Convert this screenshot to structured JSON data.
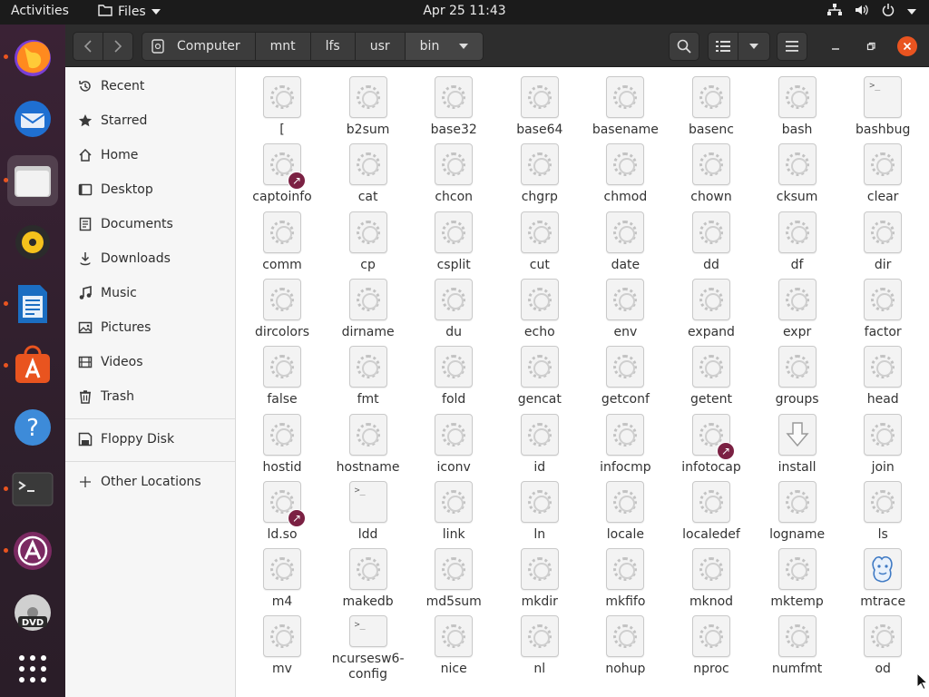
{
  "topbar": {
    "activities": "Activities",
    "app_name": "Files",
    "clock": "Apr 25  11:43"
  },
  "dock": {
    "items": [
      {
        "name": "firefox",
        "running": true
      },
      {
        "name": "thunderbird",
        "running": false
      },
      {
        "name": "files",
        "running": true,
        "active": true
      },
      {
        "name": "rhythmbox",
        "running": false
      },
      {
        "name": "libreoffice-writer",
        "running": true
      },
      {
        "name": "ubuntu-software",
        "running": true
      },
      {
        "name": "help",
        "running": false
      },
      {
        "name": "terminal",
        "running": true
      },
      {
        "name": "software-updater",
        "running": true
      },
      {
        "name": "dvd",
        "running": false
      },
      {
        "name": "show-applications",
        "running": false
      }
    ]
  },
  "path": [
    "Computer",
    "mnt",
    "lfs",
    "usr",
    "bin"
  ],
  "sidebar": {
    "items": [
      {
        "label": "Recent",
        "icon": "clock-icon"
      },
      {
        "label": "Starred",
        "icon": "star-icon"
      },
      {
        "label": "Home",
        "icon": "home-icon"
      },
      {
        "label": "Desktop",
        "icon": "desktop-icon"
      },
      {
        "label": "Documents",
        "icon": "document-icon"
      },
      {
        "label": "Downloads",
        "icon": "download-icon"
      },
      {
        "label": "Music",
        "icon": "music-icon"
      },
      {
        "label": "Pictures",
        "icon": "picture-icon"
      },
      {
        "label": "Videos",
        "icon": "video-icon"
      },
      {
        "label": "Trash",
        "icon": "trash-icon"
      }
    ],
    "devices": [
      {
        "label": "Floppy Disk",
        "icon": "floppy-icon"
      }
    ],
    "other": {
      "label": "Other Locations",
      "icon": "plus-icon"
    }
  },
  "files": [
    {
      "name": "[",
      "icon": "executable"
    },
    {
      "name": "b2sum",
      "icon": "executable"
    },
    {
      "name": "base32",
      "icon": "executable"
    },
    {
      "name": "base64",
      "icon": "executable"
    },
    {
      "name": "basename",
      "icon": "executable"
    },
    {
      "name": "basenc",
      "icon": "executable"
    },
    {
      "name": "bash",
      "icon": "executable"
    },
    {
      "name": "bashbug",
      "icon": "script"
    },
    {
      "name": "captoinfo",
      "icon": "executable",
      "link": true
    },
    {
      "name": "cat",
      "icon": "executable"
    },
    {
      "name": "chcon",
      "icon": "executable"
    },
    {
      "name": "chgrp",
      "icon": "executable"
    },
    {
      "name": "chmod",
      "icon": "executable"
    },
    {
      "name": "chown",
      "icon": "executable"
    },
    {
      "name": "cksum",
      "icon": "executable"
    },
    {
      "name": "clear",
      "icon": "executable"
    },
    {
      "name": "comm",
      "icon": "executable"
    },
    {
      "name": "cp",
      "icon": "executable"
    },
    {
      "name": "csplit",
      "icon": "executable"
    },
    {
      "name": "cut",
      "icon": "executable"
    },
    {
      "name": "date",
      "icon": "executable"
    },
    {
      "name": "dd",
      "icon": "executable"
    },
    {
      "name": "df",
      "icon": "executable"
    },
    {
      "name": "dir",
      "icon": "executable"
    },
    {
      "name": "dircolors",
      "icon": "executable"
    },
    {
      "name": "dirname",
      "icon": "executable"
    },
    {
      "name": "du",
      "icon": "executable"
    },
    {
      "name": "echo",
      "icon": "executable"
    },
    {
      "name": "env",
      "icon": "executable"
    },
    {
      "name": "expand",
      "icon": "executable"
    },
    {
      "name": "expr",
      "icon": "executable"
    },
    {
      "name": "factor",
      "icon": "executable"
    },
    {
      "name": "false",
      "icon": "executable"
    },
    {
      "name": "fmt",
      "icon": "executable"
    },
    {
      "name": "fold",
      "icon": "executable"
    },
    {
      "name": "gencat",
      "icon": "executable"
    },
    {
      "name": "getconf",
      "icon": "executable"
    },
    {
      "name": "getent",
      "icon": "executable"
    },
    {
      "name": "groups",
      "icon": "executable"
    },
    {
      "name": "head",
      "icon": "executable"
    },
    {
      "name": "hostid",
      "icon": "executable"
    },
    {
      "name": "hostname",
      "icon": "executable"
    },
    {
      "name": "iconv",
      "icon": "executable"
    },
    {
      "name": "id",
      "icon": "executable"
    },
    {
      "name": "infocmp",
      "icon": "executable"
    },
    {
      "name": "infotocap",
      "icon": "executable",
      "link": true
    },
    {
      "name": "install",
      "icon": "install"
    },
    {
      "name": "join",
      "icon": "executable"
    },
    {
      "name": "ld.so",
      "icon": "executable",
      "link": true
    },
    {
      "name": "ldd",
      "icon": "script"
    },
    {
      "name": "link",
      "icon": "executable"
    },
    {
      "name": "ln",
      "icon": "executable"
    },
    {
      "name": "locale",
      "icon": "executable"
    },
    {
      "name": "localedef",
      "icon": "executable"
    },
    {
      "name": "logname",
      "icon": "executable"
    },
    {
      "name": "ls",
      "icon": "executable"
    },
    {
      "name": "m4",
      "icon": "executable"
    },
    {
      "name": "makedb",
      "icon": "executable"
    },
    {
      "name": "md5sum",
      "icon": "executable"
    },
    {
      "name": "mkdir",
      "icon": "executable"
    },
    {
      "name": "mkfifo",
      "icon": "executable"
    },
    {
      "name": "mknod",
      "icon": "executable"
    },
    {
      "name": "mktemp",
      "icon": "executable"
    },
    {
      "name": "mtrace",
      "icon": "perl"
    },
    {
      "name": "mv",
      "icon": "executable"
    },
    {
      "name": "ncursesw6-config",
      "icon": "script"
    },
    {
      "name": "nice",
      "icon": "executable"
    },
    {
      "name": "nl",
      "icon": "executable"
    },
    {
      "name": "nohup",
      "icon": "executable"
    },
    {
      "name": "nproc",
      "icon": "executable"
    },
    {
      "name": "numfmt",
      "icon": "executable"
    },
    {
      "name": "od",
      "icon": "executable"
    }
  ],
  "colors": {
    "accent": "#e95420",
    "close_button": "#e95420",
    "link_badge": "#7b2143"
  }
}
